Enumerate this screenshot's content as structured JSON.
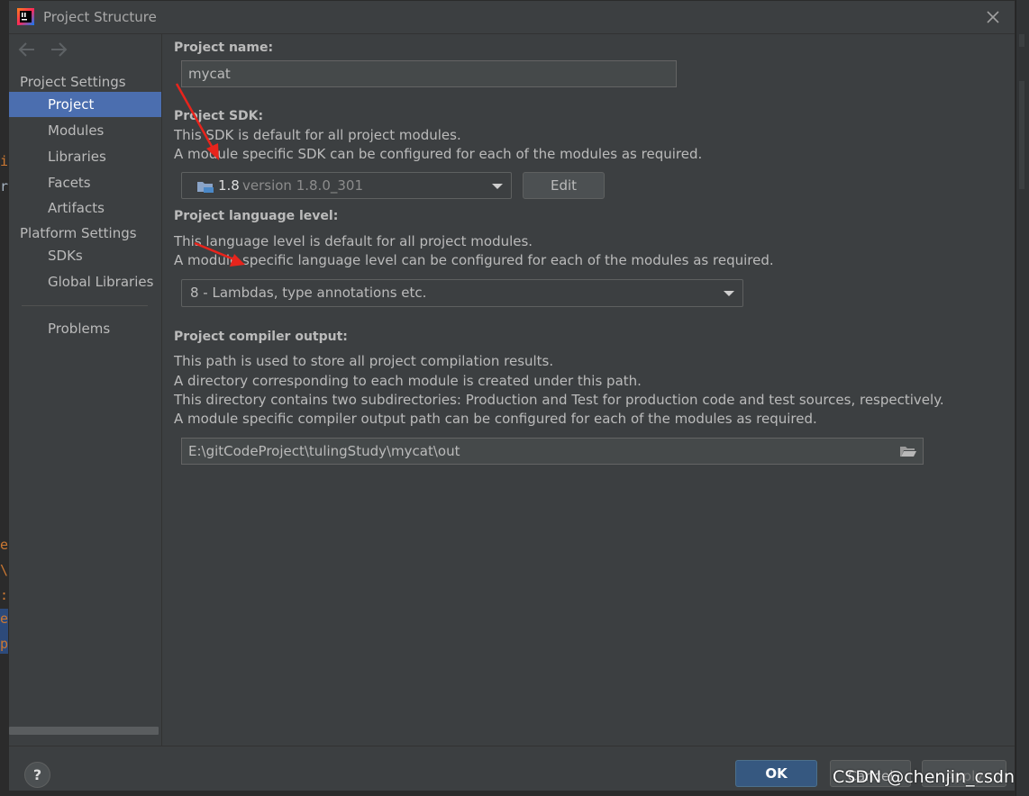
{
  "window": {
    "title": "Project Structure",
    "icon": "intellij-app-icon"
  },
  "sidebar": {
    "nav": [
      "back-arrow-icon",
      "forward-arrow-icon"
    ],
    "sections": {
      "project_settings": "Project Settings",
      "platform_settings": "Platform Settings"
    },
    "items": [
      {
        "label": "Project",
        "selected": true
      },
      {
        "label": "Modules"
      },
      {
        "label": "Libraries"
      },
      {
        "label": "Facets"
      },
      {
        "label": "Artifacts"
      },
      {
        "label": "SDKs"
      },
      {
        "label": "Global Libraries"
      },
      {
        "label": "Problems"
      }
    ]
  },
  "content": {
    "project_name": {
      "label": "Project name:",
      "value": "mycat"
    },
    "project_sdk": {
      "label": "Project SDK:",
      "line1": "This SDK is default for all project modules.",
      "line2": "A module specific SDK can be configured for each of the modules as required.",
      "selected_name": "1.8",
      "selected_version": "version 1.8.0_301",
      "edit_label": "Edit"
    },
    "language_level": {
      "label": "Project language level:",
      "line1": "This language level is default for all project modules.",
      "line2": "A module specific language level can be configured for each of the modules as required.",
      "selected": "8 - Lambdas, type annotations etc."
    },
    "compiler_output": {
      "label": "Project compiler output:",
      "line1": "This path is used to store all project compilation results.",
      "line2": "A directory corresponding to each module is created under this path.",
      "line3": "This directory contains two subdirectories: Production and Test for production code and test sources, respectively.",
      "line4": "A module specific compiler output path can be configured for each of the modules as required.",
      "path": "E:\\gitCodeProject\\tulingStudy\\mycat\\out"
    }
  },
  "footer": {
    "help_label": "?",
    "ok_label": "OK",
    "cancel_label": "Cancel",
    "apply_label": "Apply"
  },
  "watermark": "CSDN @chenjin_csdn",
  "colors": {
    "accent": "#4b6eaf",
    "primary_button": "#365880",
    "annotation_arrow": "#e8241c"
  }
}
